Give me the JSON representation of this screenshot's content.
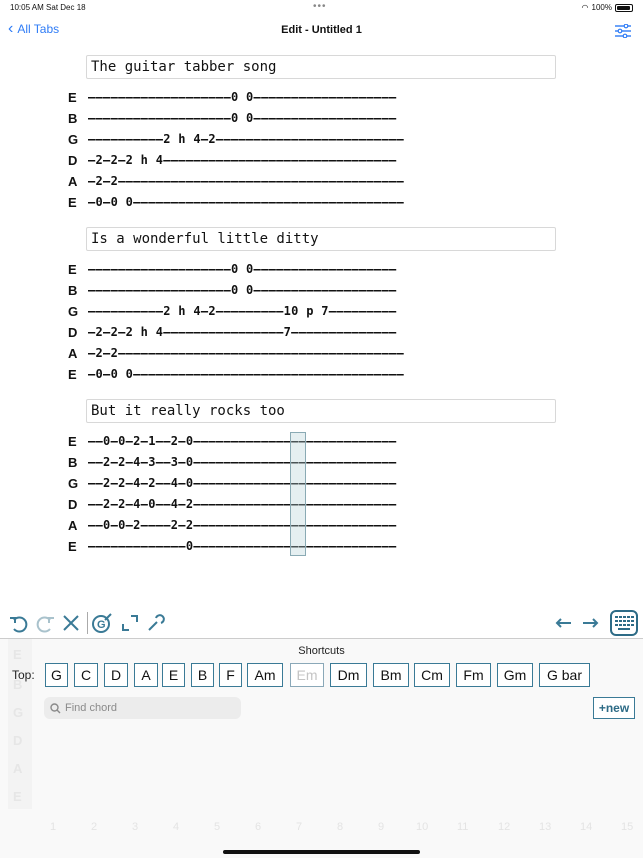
{
  "status": {
    "time": "10:05 AM",
    "date": "Sat Dec 18",
    "battery": "100%"
  },
  "nav": {
    "back_label": "All Tabs",
    "title": "Edit - Untitled 1"
  },
  "sections": [
    {
      "title": "The guitar tabber song",
      "rows": [
        {
          "string": "E",
          "line": "–––––––––––––––––––0 0–––––––––––––––––––"
        },
        {
          "string": "B",
          "line": "–––––––––––––––––––0 0–––––––––––––––––––"
        },
        {
          "string": "G",
          "line": "––––––––––2 h 4–2–––––––––––––––––––––––––"
        },
        {
          "string": "D",
          "line": "–2–2–2 h 4–––––––––––––––––––––––––––––––"
        },
        {
          "string": "A",
          "line": "–2–2––––––––––––––––––––––––––––––––––––––"
        },
        {
          "string": "E",
          "line": "–0–0 0––––––––––––––––––––––––––––––––––––"
        }
      ]
    },
    {
      "title": "Is a wonderful little ditty",
      "rows": [
        {
          "string": "E",
          "line": "–––––––––––––––––––0 0–––––––––––––––––––"
        },
        {
          "string": "B",
          "line": "–––––––––––––––––––0 0–––––––––––––––––––"
        },
        {
          "string": "G",
          "line": "––––––––––2 h 4–2–––––––––10 p 7–––––––––"
        },
        {
          "string": "D",
          "line": "–2–2–2 h 4––––––––––––––––7––––––––––––––"
        },
        {
          "string": "A",
          "line": "–2–2––––––––––––––––––––––––––––––––––––––"
        },
        {
          "string": "E",
          "line": "–0–0 0––––––––––––––––––––––––––––––––––––"
        }
      ]
    },
    {
      "title": "But it really rocks too",
      "rows": [
        {
          "string": "E",
          "line": "––0–0–2–1––2–0–––––––––––––––––––––––––––"
        },
        {
          "string": "B",
          "line": "––2–2–4–3––3–0–––––––––––––––––––––––––––"
        },
        {
          "string": "G",
          "line": "––2–2–4–2––4–0–––––––––––––––––––––––––––"
        },
        {
          "string": "D",
          "line": "––2–2–4–0––4–2–––––––––––––––––––––––––––"
        },
        {
          "string": "A",
          "line": "––0–0–2––––2–2–––––––––––––––––––––––––––"
        },
        {
          "string": "E",
          "line": "–––––––––––––0–––––––––––––––––––––––––––"
        }
      ]
    }
  ],
  "toolbar": {
    "icons": [
      "undo-icon",
      "redo-icon",
      "delete-icon",
      "chord-icon",
      "expand-icon",
      "wrench-icon",
      "arrow-left-icon",
      "arrow-right-icon",
      "keyboard-icon"
    ]
  },
  "shortcuts": {
    "label": "Shortcuts",
    "top_label": "Top:",
    "chords": [
      "G",
      "C",
      "D",
      "A",
      "E",
      "B",
      "F",
      "Am",
      "Em",
      "Dm",
      "Bm",
      "Cm",
      "Fm",
      "Gm",
      "G bar"
    ],
    "find_placeholder": "Find chord",
    "new_label": "+new"
  },
  "ghost": {
    "strings": [
      "E",
      "B",
      "G",
      "D",
      "A",
      "E"
    ],
    "frets": [
      "1",
      "2",
      "3",
      "4",
      "5",
      "6",
      "7",
      "8",
      "9",
      "10",
      "11",
      "12",
      "13",
      "14",
      "15"
    ]
  },
  "colors": {
    "accent": "#2f7cf6",
    "teal": "#2d6b86"
  }
}
